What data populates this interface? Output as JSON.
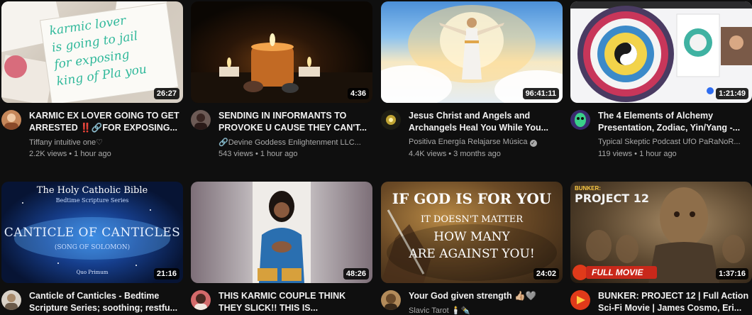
{
  "videos": [
    {
      "title": "KARMIC EX LOVER GOING TO GET ARRESTED ‼️🔗FOR EXPOSING...",
      "channel": "Tiffany intuitive one♡",
      "views": "2.2K views",
      "age": "1 hour ago",
      "duration": "26:27",
      "thumb_text": [
        "karmic lover",
        "is going to jail",
        "for exposing",
        "king of Pla you"
      ],
      "avatar_color": "#c6875a"
    },
    {
      "title": "SENDING IN INFORMANTS TO PROVOKE U CAUSE THEY CAN'T...",
      "channel": "🔗Devine Goddess Enlightenment LLC...",
      "views": "543 views",
      "age": "1 hour ago",
      "duration": "4:36",
      "avatar_color": "#6c5a55"
    },
    {
      "title": "Jesus Christ and Angels and Archangels Heal You While You...",
      "channel": "Positiva Energía Relajarse Música",
      "verified": true,
      "views": "4.4K views",
      "age": "3 months ago",
      "duration": "96:41:11",
      "avatar_color": "#2a2a1e"
    },
    {
      "title": "The 4 Elements of Alchemy Presentation, Zodiac, Yin/Yang -...",
      "channel": "Typical Skeptic Podcast UfO PaRaNoR...",
      "views": "119 views",
      "age": "1 hour ago",
      "duration": "1:21:49",
      "avatar_color": "#6a4ccf"
    },
    {
      "title": "Canticle of Canticles - Bedtime Scripture Series; soothing; restfu...",
      "duration": "21:16",
      "thumb_text": [
        "The Holy Catholic Bible",
        "Bedtime Scripture Series",
        "CANTICLE OF CANTICLES",
        "(SONG OF SOLOMON)",
        "Quo Primum"
      ],
      "avatar_color": "#d9d2c8"
    },
    {
      "title": "THIS KARMIC COUPLE THINK THEY SLICK!! THIS IS...",
      "duration": "48:26",
      "avatar_color": "#d46a6a"
    },
    {
      "title": "Your God given strength 👍🏼🩶",
      "channel": "Slavic Tarot 🕯️✒️",
      "duration": "24:02",
      "thumb_text": [
        "IF GOD IS FOR YOU",
        "IT DOESN'T MATTER",
        "HOW MANY",
        "ARE AGAINST YOU!"
      ],
      "avatar_color": "#b38b5a"
    },
    {
      "title": "BUNKER: PROJECT 12 | Full Action Sci-Fi Movie | James Cosmo, Eri...",
      "duration": "1:37:16",
      "thumb_text": [
        "BUNKER:",
        "PROJECT 12",
        "FULL MOVIE"
      ],
      "avatar_color": "#e03a1a"
    }
  ]
}
